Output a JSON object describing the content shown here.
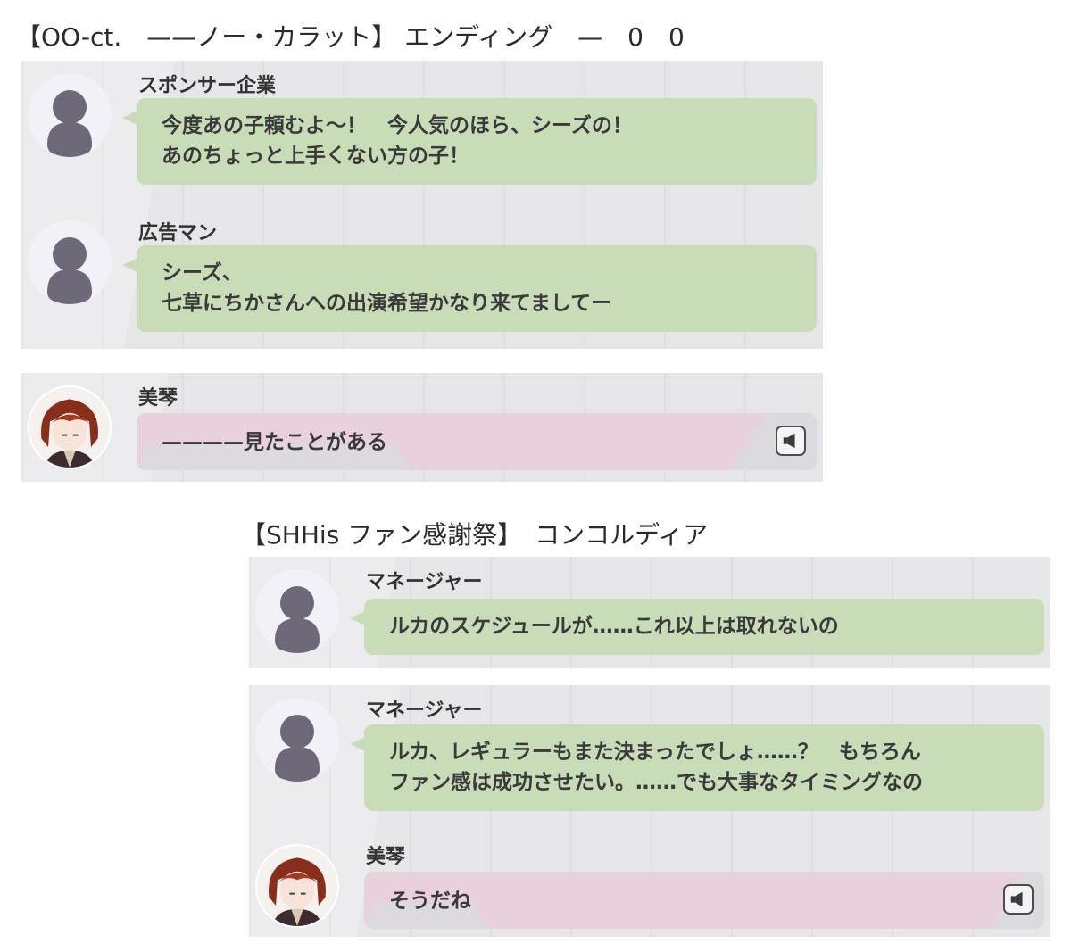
{
  "sections": [
    {
      "heading": "【OO-ct.　——ノー・カラット】 エンディング　—　0　0",
      "messages": [
        {
          "speaker": "スポンサー企業",
          "lines": [
            "今度あの子頼むよ～！　今人気のほら、シーズの！",
            "あのちょっと上手くない方の子！"
          ],
          "avatar": "silhouette-icon",
          "bubble_color": "#c9dcb8"
        },
        {
          "speaker": "広告マン",
          "lines": [
            "シーズ、",
            "七草にちかさんへの出演希望かなり来てましてー"
          ],
          "avatar": "silhouette-icon",
          "bubble_color": "#c9dcb8"
        }
      ],
      "reply": {
        "speaker": "美琴",
        "lines": [
          "————見たことがある"
        ],
        "avatar": "mikoto-portrait",
        "bubble_color": "#e8d0dc",
        "voice_icon": "speaker-icon"
      }
    },
    {
      "heading": "【SHHis ファン感謝祭】　コンコルディア",
      "messages": [
        {
          "speaker": "マネージャー",
          "lines": [
            "ルカのスケジュールが……これ以上は取れないの"
          ],
          "avatar": "silhouette-icon",
          "bubble_color": "#c9dcb8"
        },
        {
          "speaker": "マネージャー",
          "lines": [
            "ルカ、レギュラーもまた決まったでしょ……？　もちろん",
            "ファン感は成功させたい。……でも大事なタイミングなの"
          ],
          "avatar": "silhouette-icon",
          "bubble_color": "#c9dcb8"
        },
        {
          "speaker": "美琴",
          "lines": [
            "そうだね"
          ],
          "avatar": "mikoto-portrait",
          "bubble_color": "#e8d0dc",
          "voice_icon": "speaker-icon"
        }
      ]
    }
  ]
}
